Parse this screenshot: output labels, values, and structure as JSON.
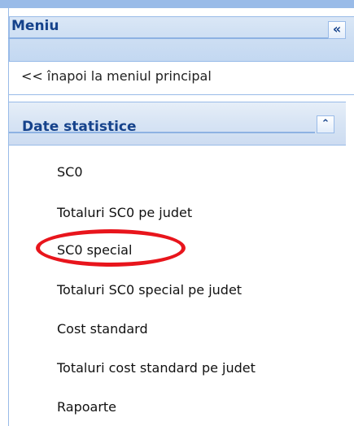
{
  "panel": {
    "title": "Meniu",
    "collapse_glyph": "«"
  },
  "back_link": "<< înapoi la meniul principal",
  "group": {
    "title": "Date statistice",
    "collapse_glyph": "⌃"
  },
  "items": [
    "SC0",
    "Totaluri SC0 pe judet",
    "SC0 special",
    "Totaluri SC0 special pe judet",
    "Cost standard",
    "Totaluri cost standard pe judet",
    "Rapoarte"
  ],
  "colors": {
    "accent_blue": "#15428b",
    "border_blue": "#99bbe8",
    "highlight_red": "#e8151c"
  },
  "highlighted_item": "SC0 special"
}
